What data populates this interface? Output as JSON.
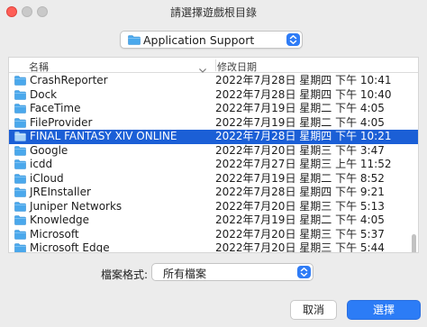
{
  "window": {
    "title": "請選擇遊戲根目錄"
  },
  "location": {
    "selected": "Application Support"
  },
  "list": {
    "columns": {
      "name": "名稱",
      "date": "修改日期"
    },
    "rows": [
      {
        "name": "CrashReporter",
        "date": "2022年7月28日 星期四 下午 10:41",
        "selected": false
      },
      {
        "name": "Dock",
        "date": "2022年7月28日 星期四 下午 10:40",
        "selected": false
      },
      {
        "name": "FaceTime",
        "date": "2022年7月19日 星期二 下午 4:05",
        "selected": false
      },
      {
        "name": "FileProvider",
        "date": "2022年7月19日 星期二 下午 4:05",
        "selected": false
      },
      {
        "name": "FINAL FANTASY XIV ONLINE",
        "date": "2022年7月28日 星期四 下午 10:21",
        "selected": true
      },
      {
        "name": "Google",
        "date": "2022年7月20日 星期三 下午 3:47",
        "selected": false
      },
      {
        "name": "icdd",
        "date": "2022年7月27日 星期三 上午 11:52",
        "selected": false
      },
      {
        "name": "iCloud",
        "date": "2022年7月19日 星期二 下午 8:52",
        "selected": false
      },
      {
        "name": "JREInstaller",
        "date": "2022年7月28日 星期四 下午 9:21",
        "selected": false
      },
      {
        "name": "Juniper Networks",
        "date": "2022年7月20日 星期三 下午 5:13",
        "selected": false
      },
      {
        "name": "Knowledge",
        "date": "2022年7月19日 星期二 下午 4:05",
        "selected": false
      },
      {
        "name": "Microsoft",
        "date": "2022年7月20日 星期三 下午 5:37",
        "selected": false
      },
      {
        "name": "Microsoft Edge",
        "date": "2022年7月20日 星期三 下午 5:44",
        "selected": false
      }
    ]
  },
  "format": {
    "label": "檔案格式:",
    "selected": "所有檔案"
  },
  "buttons": {
    "cancel": "取消",
    "choose": "選擇"
  },
  "colors": {
    "accent": "#2c7cf6",
    "selection": "#1b5fd6",
    "folder": "#4aa8ec",
    "close": "#fe5f57"
  }
}
